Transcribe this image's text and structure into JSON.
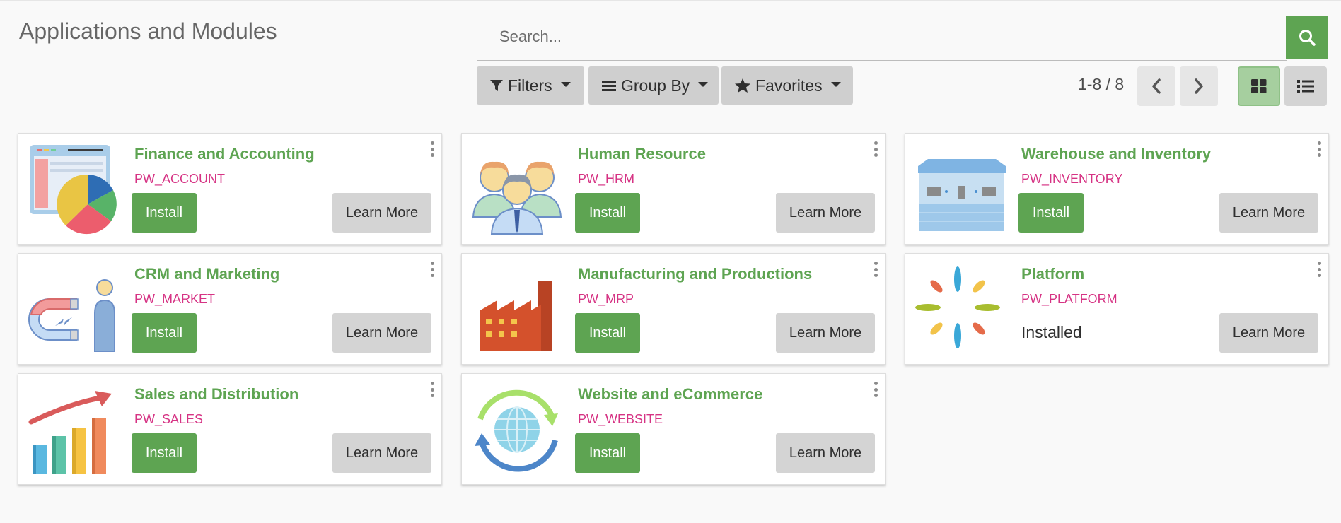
{
  "header": {
    "title": "Applications and Modules",
    "search_placeholder": "Search..."
  },
  "toolbar": {
    "filters_label": "Filters",
    "groupby_label": "Group By",
    "favorites_label": "Favorites"
  },
  "pager": {
    "value": "1-8 / 8"
  },
  "view": {
    "active": "kanban"
  },
  "colors": {
    "accent": "#5ea452",
    "technical_name": "#d63384"
  },
  "apps": [
    {
      "name": "Finance and Accounting",
      "technical": "PW_ACCOUNT",
      "icon": "finance-chart-icon",
      "state": "install",
      "install_label": "Install",
      "learn_label": "Learn More"
    },
    {
      "name": "Human Resource",
      "technical": "PW_HRM",
      "icon": "people-group-icon",
      "state": "install",
      "install_label": "Install",
      "learn_label": "Learn More"
    },
    {
      "name": "Warehouse and Inventory",
      "technical": "PW_INVENTORY",
      "icon": "warehouse-icon",
      "state": "install",
      "install_label": "Install",
      "learn_label": "Learn More"
    },
    {
      "name": "CRM and Marketing",
      "technical": "PW_MARKET",
      "icon": "magnet-person-icon",
      "state": "install",
      "install_label": "Install",
      "learn_label": "Learn More"
    },
    {
      "name": "Manufacturing and Productions",
      "technical": "PW_MRP",
      "icon": "factory-icon",
      "state": "install",
      "install_label": "Install",
      "learn_label": "Learn More"
    },
    {
      "name": "Platform",
      "technical": "PW_PLATFORM",
      "icon": "platform-petals-icon",
      "state": "installed",
      "installed_label": "Installed",
      "learn_label": "Learn More"
    },
    {
      "name": "Sales and Distribution",
      "technical": "PW_SALES",
      "icon": "sales-bars-icon",
      "state": "install",
      "install_label": "Install",
      "learn_label": "Learn More"
    },
    {
      "name": "Website and eCommerce",
      "technical": "PW_WEBSITE",
      "icon": "globe-sync-icon",
      "state": "install",
      "install_label": "Install",
      "learn_label": "Learn More"
    }
  ]
}
